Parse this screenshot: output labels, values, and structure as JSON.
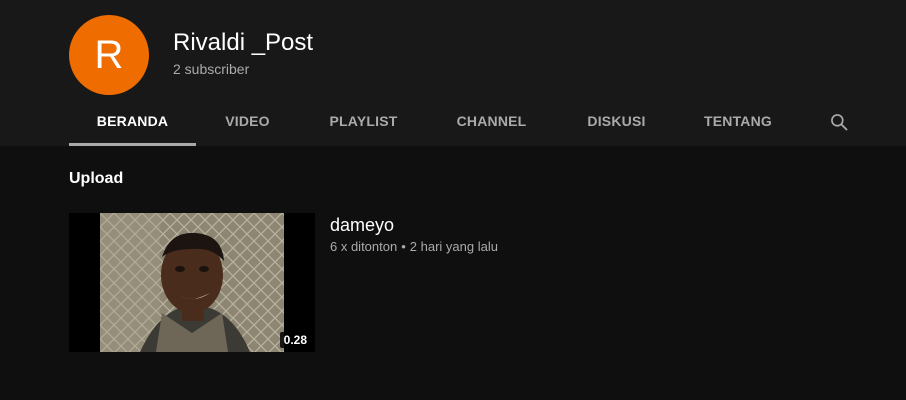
{
  "colors": {
    "avatar_bg": "#ef6c00",
    "header_bg": "#181818",
    "page_bg": "#0f0f0f",
    "secondary_text": "#aaaaaa"
  },
  "channel": {
    "avatar_letter": "R",
    "name": "Rivaldi _Post",
    "subscribers": "2 subscriber"
  },
  "tabs": [
    {
      "label": "BERANDA",
      "active": true
    },
    {
      "label": "VIDEO",
      "active": false
    },
    {
      "label": "PLAYLIST",
      "active": false
    },
    {
      "label": "CHANNEL",
      "active": false
    },
    {
      "label": "DISKUSI",
      "active": false
    },
    {
      "label": "TENTANG",
      "active": false
    }
  ],
  "search_icon": "search-icon",
  "section": {
    "title": "Upload"
  },
  "video": {
    "title": "dameyo",
    "views": "6 x ditonton",
    "separator": "•",
    "age": "2 hari yang lalu",
    "duration": "0.28"
  }
}
